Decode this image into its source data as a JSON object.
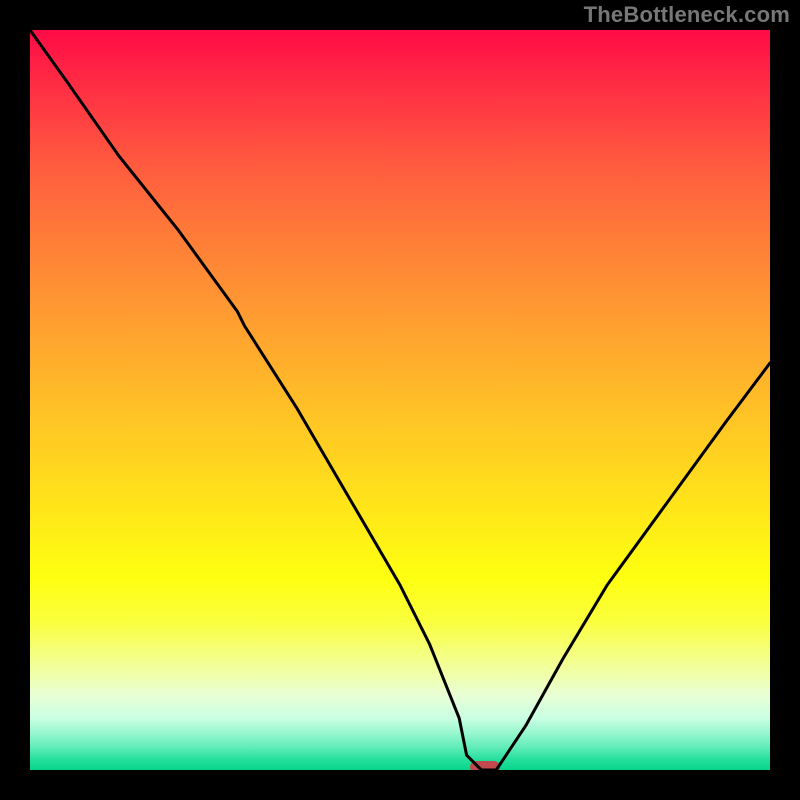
{
  "watermark": "TheBottleneck.com",
  "colors": {
    "background": "#000000",
    "curve": "#000000",
    "marker": "#c24a4f",
    "gradient_top": "#ff0b46",
    "gradient_bottom": "#06d48a"
  },
  "chart_data": {
    "type": "line",
    "title": "",
    "xlabel": "",
    "ylabel": "",
    "xlim": [
      0,
      100
    ],
    "ylim": [
      0,
      100
    ],
    "x": [
      0,
      5,
      12,
      20,
      28,
      29,
      36,
      43,
      50,
      54,
      58,
      59,
      61,
      63,
      67,
      72,
      78,
      86,
      94,
      100
    ],
    "values": [
      100,
      93,
      83,
      73,
      62,
      60,
      49,
      37,
      25,
      17,
      7,
      2,
      0,
      0,
      6,
      15,
      25,
      36,
      47,
      55
    ],
    "marker": {
      "x_start": 59.5,
      "x_end": 63.5,
      "y": 0
    },
    "notes": "x/y in percent of plot area; y=0 is bottom, y=100 is top. Curve drops from top-left to a flat minimum near x≈61–63, then rises toward upper right."
  }
}
